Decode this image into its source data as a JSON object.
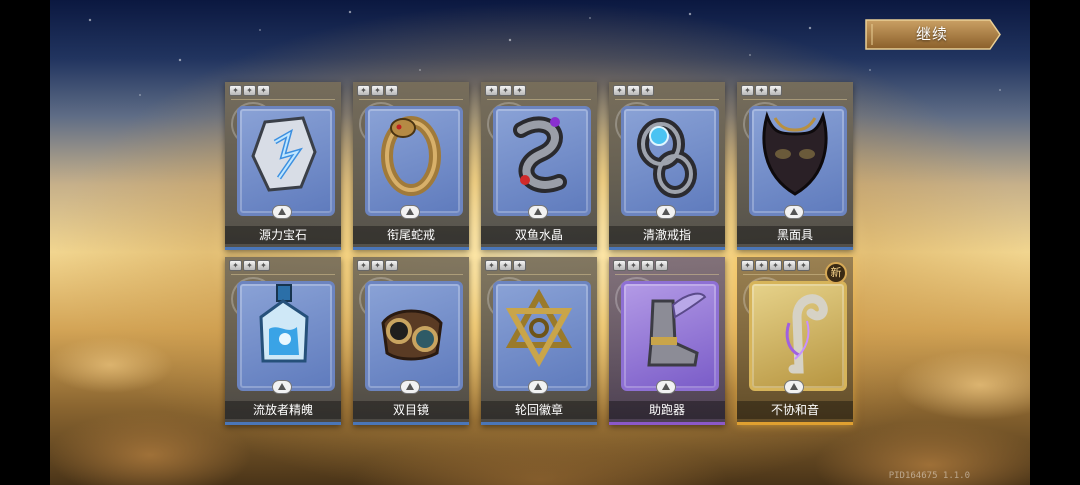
{
  "header": {
    "continue_label": "继续"
  },
  "cards": [
    {
      "name": "源力宝石",
      "stars": 3,
      "rarity": "blue",
      "icon": "rune-stone-icon",
      "is_new": false
    },
    {
      "name": "衔尾蛇戒",
      "stars": 3,
      "rarity": "blue",
      "icon": "serpent-ring-icon",
      "is_new": false
    },
    {
      "name": "双鱼水晶",
      "stars": 3,
      "rarity": "blue",
      "icon": "twin-fish-crystal-icon",
      "is_new": false
    },
    {
      "name": "清澈戒指",
      "stars": 3,
      "rarity": "blue",
      "icon": "clear-ring-icon",
      "is_new": false
    },
    {
      "name": "黑面具",
      "stars": 3,
      "rarity": "blue",
      "icon": "black-mask-icon",
      "is_new": false
    },
    {
      "name": "流放者精魄",
      "stars": 3,
      "rarity": "blue",
      "icon": "exile-soul-bottle-icon",
      "is_new": false
    },
    {
      "name": "双目镜",
      "stars": 3,
      "rarity": "blue",
      "icon": "goggles-icon",
      "is_new": false
    },
    {
      "name": "轮回徽章",
      "stars": 3,
      "rarity": "blue",
      "icon": "samsara-emblem-icon",
      "is_new": false
    },
    {
      "name": "助跑器",
      "stars": 4,
      "rarity": "purple",
      "icon": "winged-boot-icon",
      "is_new": false
    },
    {
      "name": "不协和音",
      "stars": 5,
      "rarity": "gold",
      "icon": "dissonance-hook-icon",
      "is_new": true
    }
  ],
  "new_label": "新",
  "version_text": "PID164675 1.1.0",
  "colors": {
    "blue": "#4a76b8",
    "purple": "#8b58c8",
    "gold": "#e0a030"
  }
}
